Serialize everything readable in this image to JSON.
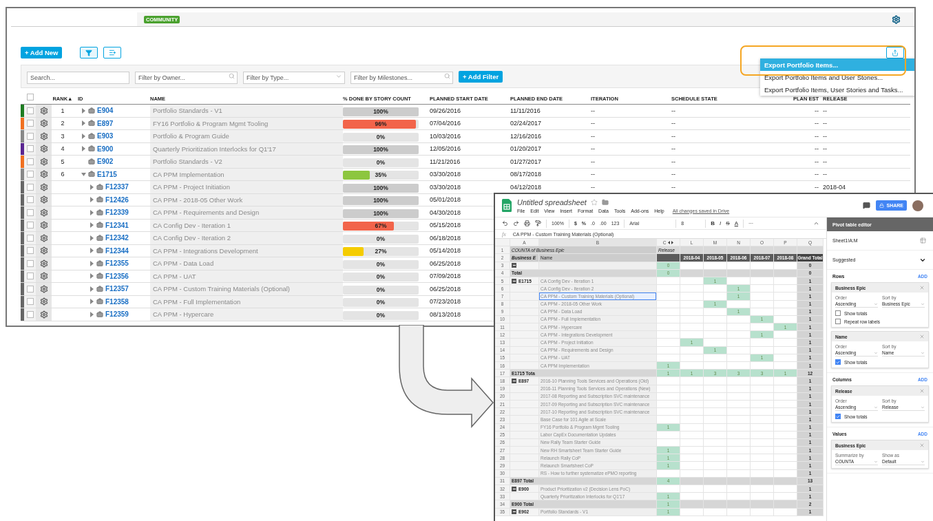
{
  "rally": {
    "badge": "COMMUNITY",
    "toolbar": {
      "add_new": "+ Add New",
      "filter_selected": true
    },
    "filters": {
      "search": {
        "placeholder": "Search..."
      },
      "owner": {
        "placeholder": "Filter by Owner..."
      },
      "type": {
        "placeholder": "Filter by Type..."
      },
      "milestones": {
        "placeholder": "Filter by Milestones..."
      },
      "add_filter": "+ Add Filter"
    },
    "export_menu": [
      {
        "label": "Export Portfolio Items...",
        "selected": true
      },
      {
        "label": "Export Portfolio Items and User Stories...",
        "selected": false
      },
      {
        "label": "Export Portfolio Items, User Stories and Tasks...",
        "selected": false
      }
    ],
    "table": {
      "header_checked": false,
      "columns": [
        "RANK▲",
        "ID",
        "NAME",
        "% DONE BY STORY COUNT",
        "PLANNED START DATE",
        "PLANNED END DATE",
        "ITERATION",
        "SCHEDULE STATE",
        "PLAN EST",
        "RELEASE"
      ],
      "rows": [
        {
          "color": "#1e7d22",
          "checked": false,
          "rank": "1",
          "expanded": false,
          "id": "E904",
          "name": "Portfolio Standards - V1",
          "level": 1,
          "bar": {
            "color": "#cccccc"
          },
          "pct": "100%",
          "start": "09/26/2016",
          "end": "11/11/2016",
          "iteration": "--",
          "schedule": "--",
          "plan_est": "--",
          "release": "--"
        },
        {
          "color": "#f07020",
          "checked": false,
          "rank": "2",
          "expanded": false,
          "id": "E897",
          "name": "FY16 Portfolio & Program Mgmt Tooling",
          "level": 0.96,
          "bar": {
            "color": "#f2644a"
          },
          "pct": "96%",
          "start": "07/04/2016",
          "end": "02/24/2017",
          "iteration": "--",
          "schedule": "--",
          "plan_est": "--",
          "release": "--"
        },
        {
          "color": "#888888",
          "checked": false,
          "rank": "3",
          "expanded": false,
          "id": "E903",
          "name": "Portfolio & Program Guide",
          "level": 0,
          "pct": "0%",
          "start": "10/03/2016",
          "end": "12/16/2016",
          "iteration": "--",
          "schedule": "--",
          "plan_est": "--",
          "release": "--"
        },
        {
          "color": "#5a2591",
          "checked": false,
          "rank": "4",
          "expanded": false,
          "id": "E900",
          "name": "Quarterly Prioritization Interlocks for Q1'17",
          "level": 1,
          "bar": {
            "color": "#cccccc"
          },
          "pct": "100%",
          "start": "12/05/2016",
          "end": "01/20/2017",
          "iteration": "--",
          "schedule": "--",
          "plan_est": "--",
          "release": "--"
        },
        {
          "color": "#f07020",
          "checked": false,
          "rank": "5",
          "id": "E902",
          "name": "Portfolio Standards - V2",
          "level": 0,
          "pct": "0%",
          "start": "11/21/2016",
          "end": "01/27/2017",
          "iteration": "--",
          "schedule": "--",
          "plan_est": "--",
          "release": "--"
        },
        {
          "color": "#888888",
          "checked": false,
          "rank": "6",
          "expanded": true,
          "id": "E1715",
          "name": "CA PPM Implementation",
          "level": 0.35,
          "bar": {
            "color": "#8cc63f"
          },
          "pct": "35%",
          "start": "03/30/2018",
          "end": "08/17/2018",
          "iteration": "--",
          "schedule": "--",
          "plan_est": "--",
          "release": "--",
          "children": [
            {
              "color": "#666666",
              "checked": false,
              "expanded": false,
              "id": "F12337",
              "name": "CA PPM - Project Initiation",
              "level": 1,
              "bar": {
                "color": "#cccccc"
              },
              "pct": "100%",
              "start": "03/30/2018",
              "end": "04/12/2018",
              "iteration": "--",
              "schedule": "--",
              "plan_est": "--",
              "release": "2018-04"
            },
            {
              "color": "#666666",
              "checked": false,
              "expanded": false,
              "id": "F12426",
              "name": "CA PPM - 2018-05 Other Work",
              "level": 1,
              "bar": {
                "color": "#cccccc"
              },
              "pct": "100%",
              "start": "05/01/2018"
            },
            {
              "color": "#666666",
              "checked": false,
              "expanded": false,
              "id": "F12339",
              "name": "CA PPM - Requirements and Design",
              "level": 1,
              "bar": {
                "color": "#cccccc"
              },
              "pct": "100%",
              "start": "04/30/2018"
            },
            {
              "color": "#666666",
              "checked": false,
              "expanded": false,
              "id": "F12341",
              "name": "CA Config Dev - Iteration 1",
              "level": 0.67,
              "bar": {
                "color": "#f2644a"
              },
              "pct": "67%",
              "start": "05/15/2018"
            },
            {
              "color": "#666666",
              "checked": false,
              "expanded": false,
              "id": "F12342",
              "name": "CA Config Dev - Iteration 2",
              "level": 0,
              "pct": "0%",
              "start": "06/18/2018"
            },
            {
              "color": "#666666",
              "checked": false,
              "expanded": false,
              "id": "F12344",
              "name": "CA PPM - Integrations Development",
              "level": 0.27,
              "bar": {
                "color": "#f5cc00"
              },
              "pct": "27%",
              "start": "05/14/2018"
            },
            {
              "color": "#666666",
              "checked": false,
              "expanded": false,
              "id": "F12355",
              "name": "CA PPM - Data Load",
              "level": 0,
              "pct": "0%",
              "start": "06/25/2018"
            },
            {
              "color": "#666666",
              "checked": false,
              "expanded": false,
              "id": "F12356",
              "name": "CA PPM - UAT",
              "level": 0,
              "pct": "0%",
              "start": "07/09/2018"
            },
            {
              "color": "#666666",
              "checked": false,
              "expanded": false,
              "id": "F12357",
              "name": "CA PPM - Custom Training Materials (Optional)",
              "level": 0,
              "pct": "0%",
              "start": "06/25/2018"
            },
            {
              "color": "#666666",
              "checked": false,
              "expanded": false,
              "id": "F12358",
              "name": "CA PPM - Full Implementation",
              "level": 0,
              "pct": "0%",
              "start": "07/23/2018"
            },
            {
              "color": "#666666",
              "checked": false,
              "expanded": false,
              "id": "F12359",
              "name": "CA PPM - Hypercare",
              "level": 0,
              "pct": "0%",
              "start": "08/13/2018"
            }
          ]
        }
      ]
    }
  },
  "sheet": {
    "title": "Untitled spreadsheet",
    "menu": [
      "File",
      "Edit",
      "View",
      "Insert",
      "Format",
      "Data",
      "Tools",
      "Add-ons",
      "Help"
    ],
    "save_status": "All changes saved in Drive",
    "share": "SHARE",
    "toolbar": {
      "zoom": "100%",
      "currency": "$",
      "percent": "%",
      "dec_less": ".0",
      "dec_more": ".00",
      "format": "123",
      "font": "Arial",
      "size": "8",
      "bold": "B",
      "italic": "I",
      "strike": "S",
      "text_color": "A",
      "more": "···"
    },
    "formula": {
      "fx": "fx",
      "value": "CA PPM -  Custom Training Materials (Optional)"
    },
    "column_headers": [
      "A",
      "B",
      "C",
      "L",
      "M",
      "N",
      "O",
      "P",
      "Q"
    ],
    "rows": [
      {
        "n": "1",
        "kind": "title",
        "selected": false,
        "a": "COUNTA of Business Epic",
        "cells": {
          "C": "Release"
        }
      },
      {
        "n": "2",
        "kind": "heading",
        "selected": false,
        "a": "Business E",
        "b": "Name",
        "cells": {
          "L": "2018-04",
          "M": "2018-05",
          "N": "2018-06",
          "O": "2018-07",
          "P": "2018-08",
          "Q": "Grand Total"
        }
      },
      {
        "n": "3",
        "kind": "data",
        "selected": false,
        "expanded": true,
        "cells": {
          "C": "0",
          "Q": "0"
        }
      },
      {
        "n": "4",
        "kind": "total",
        "selected": false,
        "a": "Total",
        "cells": {
          "C": "0",
          "Q": "0"
        }
      },
      {
        "n": "5",
        "kind": "data",
        "selected": false,
        "expanded": true,
        "a": "E1715",
        "b": "CA Config Dev - Iteration 1",
        "cells": {
          "M": "1",
          "Q": "1"
        }
      },
      {
        "n": "6",
        "kind": "data",
        "selected": false,
        "b": "CA Config Dev - Iteration 2",
        "cells": {
          "N": "1",
          "Q": "1"
        }
      },
      {
        "n": "7",
        "kind": "data",
        "selected": true,
        "b": "CA PPM - Custom Training Materials (Optional)",
        "cells": {
          "N": "1",
          "Q": "1"
        }
      },
      {
        "n": "8",
        "kind": "data",
        "selected": false,
        "b": "CA PPM - 2018-05 Other Work",
        "cells": {
          "M": "1",
          "Q": "1"
        }
      },
      {
        "n": "9",
        "kind": "data",
        "selected": false,
        "b": "CA PPM - Data Load",
        "cells": {
          "N": "1",
          "Q": "1"
        }
      },
      {
        "n": "10",
        "kind": "data",
        "selected": false,
        "b": "CA PPM - Full Implementation",
        "cells": {
          "O": "1",
          "Q": "1"
        }
      },
      {
        "n": "11",
        "kind": "data",
        "selected": false,
        "b": "CA PPM - Hypercare",
        "cells": {
          "P": "1",
          "Q": "1"
        }
      },
      {
        "n": "12",
        "kind": "data",
        "selected": false,
        "b": "CA PPM - Integrations Development",
        "cells": {
          "O": "1",
          "Q": "1"
        }
      },
      {
        "n": "13",
        "kind": "data",
        "selected": false,
        "b": "CA PPM - Project Initiation",
        "cells": {
          "L": "1",
          "Q": "1"
        }
      },
      {
        "n": "14",
        "kind": "data",
        "selected": false,
        "b": "CA PPM - Requirements and Design",
        "cells": {
          "M": "1",
          "Q": "1"
        }
      },
      {
        "n": "15",
        "kind": "data",
        "selected": false,
        "b": "CA PPM - UAT",
        "cells": {
          "O": "1",
          "Q": "1"
        }
      },
      {
        "n": "16",
        "kind": "data",
        "selected": false,
        "b": "CA PPM Implementation",
        "cells": {
          "C": "1",
          "Q": "1"
        }
      },
      {
        "n": "17",
        "kind": "total",
        "selected": false,
        "a": "E1715 Tota",
        "cells": {
          "C": "1",
          "L": "1",
          "M": "3",
          "N": "3",
          "O": "3",
          "P": "1",
          "Q": "12"
        }
      },
      {
        "n": "18",
        "kind": "data",
        "selected": false,
        "expanded": true,
        "a": "E897",
        "b": "2016-10 Planning Tools Services and Operations (Old)",
        "cells": {
          "Q": "1"
        }
      },
      {
        "n": "19",
        "kind": "data",
        "selected": false,
        "b": "2016-11 Planning Tools Services and Operations (New)",
        "cells": {
          "Q": "1"
        }
      },
      {
        "n": "20",
        "kind": "data",
        "selected": false,
        "b": "2017-08 Reporting and Subscription SVC maintenance",
        "cells": {
          "Q": "1"
        }
      },
      {
        "n": "21",
        "kind": "data",
        "selected": false,
        "b": "2017-09 Reporting and Subscription SVC maintenance",
        "cells": {
          "Q": "1"
        }
      },
      {
        "n": "22",
        "kind": "data",
        "selected": false,
        "b": "2017-10 Reporting and Subscription SVC maintenance",
        "cells": {
          "Q": "1"
        }
      },
      {
        "n": "23",
        "kind": "data",
        "selected": false,
        "b": "Base Case for 101 Agile at Scale",
        "cells": {
          "Q": "1"
        }
      },
      {
        "n": "24",
        "kind": "data",
        "selected": false,
        "b": "FY16 Portfolio & Program Mgmt Tooling",
        "cells": {
          "C": "1",
          "Q": "1"
        }
      },
      {
        "n": "25",
        "kind": "data",
        "selected": false,
        "b": "Labor CapEx Documentation Updates",
        "cells": {
          "Q": "1"
        }
      },
      {
        "n": "26",
        "kind": "data",
        "selected": false,
        "b": "New Rally Team Starter Guide",
        "cells": {
          "Q": "1"
        }
      },
      {
        "n": "27",
        "kind": "data",
        "selected": false,
        "b": "New RH Smartsheet Team Starter Guide",
        "cells": {
          "C": "1",
          "Q": "1"
        }
      },
      {
        "n": "28",
        "kind": "data",
        "selected": false,
        "b": "Relaunch Rally CoP",
        "cells": {
          "C": "1",
          "Q": "1"
        }
      },
      {
        "n": "29",
        "kind": "data",
        "selected": false,
        "b": "Relaunch Smartsheet CoP",
        "cells": {
          "C": "1",
          "Q": "1"
        }
      },
      {
        "n": "30",
        "kind": "data",
        "selected": false,
        "b": "RS - How to further systematize ePMO reporting",
        "cells": {
          "Q": "1"
        }
      },
      {
        "n": "31",
        "kind": "total",
        "selected": false,
        "a": "E897 Total",
        "cells": {
          "C": "4",
          "Q": "13"
        }
      },
      {
        "n": "32",
        "kind": "data",
        "selected": false,
        "expanded": true,
        "a": "E900",
        "b": "Product Prioritization v2 (Decision Lens PoC)",
        "cells": {
          "Q": "1"
        }
      },
      {
        "n": "33",
        "kind": "data",
        "selected": false,
        "b": "Quarterly Prioritization Interlocks for Q1'17",
        "cells": {
          "C": "1",
          "Q": "1"
        }
      },
      {
        "n": "34",
        "kind": "total",
        "selected": false,
        "a": "E900 Total",
        "cells": {
          "C": "1",
          "Q": "2"
        }
      },
      {
        "n": "35",
        "kind": "data",
        "selected": false,
        "expanded": true,
        "a": "E902",
        "b": "Portfolio Standards - V1",
        "cells": {
          "C": "1",
          "Q": "1"
        }
      }
    ],
    "pivot": {
      "title": "Pivot table editor",
      "range": "Sheet1!A:M",
      "suggested": "Suggested",
      "sections": [
        {
          "title": "Rows",
          "add": "ADD",
          "cards": [
            {
              "title": "Business Epic",
              "fields": [
                {
                  "label": "Order",
                  "value": "Ascending"
                },
                {
                  "label": "Sort by",
                  "value": "Business Epic"
                }
              ],
              "options": [
                {
                  "label": "Show totals",
                  "checked": false
                },
                {
                  "label": "Repeat row labels",
                  "checked": false
                }
              ]
            },
            {
              "title": "Name",
              "fields": [
                {
                  "label": "Order",
                  "value": "Ascending"
                },
                {
                  "label": "Sort by",
                  "value": "Name"
                }
              ],
              "options": [
                {
                  "label": "Show totals",
                  "checked": true
                }
              ]
            }
          ]
        },
        {
          "title": "Columns",
          "add": "ADD",
          "cards": [
            {
              "title": "Release",
              "fields": [
                {
                  "label": "Order",
                  "value": "Ascending"
                },
                {
                  "label": "Sort by",
                  "value": "Release"
                }
              ],
              "options": [
                {
                  "label": "Show totals",
                  "checked": true
                }
              ]
            }
          ]
        },
        {
          "title": "Values",
          "add": "ADD",
          "cards": [
            {
              "title": "Business Epic",
              "fields": [
                {
                  "label": "Summarize by",
                  "value": "COUNTA"
                },
                {
                  "label": "Show as",
                  "value": "Default"
                }
              ]
            }
          ]
        }
      ]
    }
  }
}
